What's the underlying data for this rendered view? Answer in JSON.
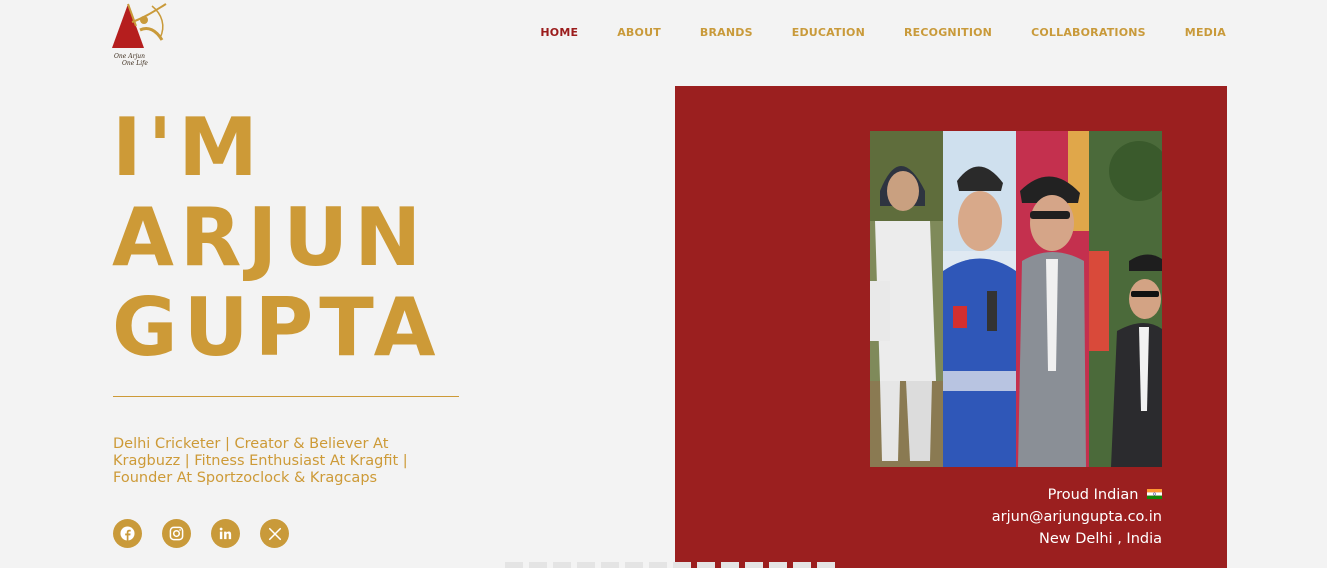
{
  "brand": {
    "tagline_line1": "One Arjun",
    "tagline_line2": "One Life"
  },
  "nav": {
    "items": [
      {
        "label": "HOME",
        "active": true
      },
      {
        "label": "ABOUT",
        "active": false
      },
      {
        "label": "BRANDS",
        "active": false
      },
      {
        "label": "EDUCATION",
        "active": false
      },
      {
        "label": "RECOGNITION",
        "active": false
      },
      {
        "label": "COLLABORATIONS",
        "active": false
      },
      {
        "label": "MEDIA",
        "active": false
      }
    ]
  },
  "hero": {
    "line1": "I'M",
    "line2": "ARJUN",
    "line3": "GUPTA",
    "bio": "Delhi Cricketer | Creator & Believer At Kragbuzz | Fitness Enthusiast At Kragfit | Founder At Sportzoclock & Kragcaps"
  },
  "social": [
    {
      "icon": "facebook-icon"
    },
    {
      "icon": "instagram-icon"
    },
    {
      "icon": "linkedin-icon"
    },
    {
      "icon": "x-twitter-icon"
    }
  ],
  "contact": {
    "line1": "Proud Indian",
    "email": "arjun@arjungupta.co.in",
    "location": "New Delhi , India"
  },
  "colors": {
    "accent": "#cd9a37",
    "panel": "#9b1f1f",
    "active_nav": "#9b1c1c",
    "background": "#f3f3f3"
  }
}
